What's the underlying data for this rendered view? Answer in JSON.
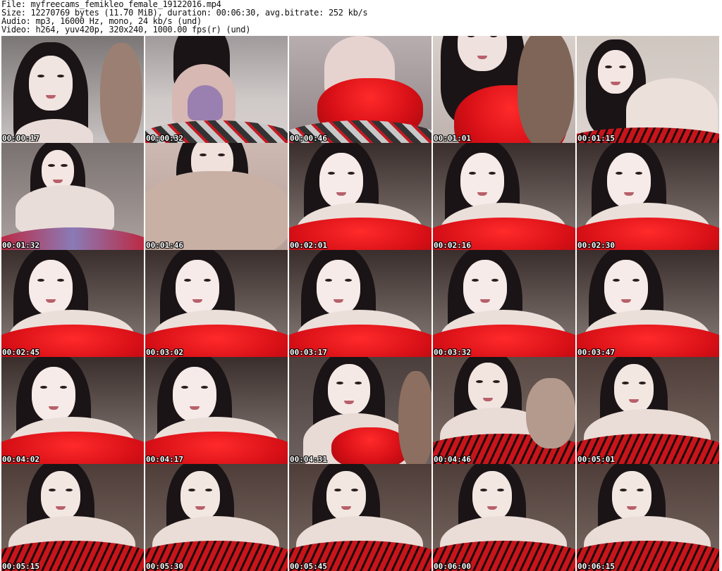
{
  "header": {
    "file_line": "File: myfreecams_femikleo_female_19122016.mp4",
    "size_line": "Size: 12270769 bytes (11.70 MiB), duration: 00:06:30, avg.bitrate: 252 kb/s",
    "audio_line": "Audio: mp3, 16000 Hz, mono, 24 kb/s (und)",
    "video_line": "Video: h264, yuv420p, 320x240, 1000.00 fps(r) (und)"
  },
  "colors": {
    "background": "#ffffff",
    "text": "#111111",
    "timestamp": "#ffffff",
    "blanket_red": "#e0141c",
    "skin": "#f4e6e2",
    "hair": "#1a1416"
  },
  "thumbnails": [
    {
      "time": "00:00:17",
      "scene": "closeup-left-hand"
    },
    {
      "time": "00:00:32",
      "scene": "sitting-bed"
    },
    {
      "time": "00:00:46",
      "scene": "red-blanket-move"
    },
    {
      "time": "00:01:01",
      "scene": "blur-red"
    },
    {
      "time": "00:01:15",
      "scene": "lying-bed"
    },
    {
      "time": "00:01:32",
      "scene": "lying-purple"
    },
    {
      "time": "00:01:46",
      "scene": "hand-closeup"
    },
    {
      "time": "00:02:01",
      "scene": "face-red-pillow"
    },
    {
      "time": "00:02:16",
      "scene": "face-red-pillow"
    },
    {
      "time": "00:02:30",
      "scene": "face-red-pillow"
    },
    {
      "time": "00:02:45",
      "scene": "face-red-pillow"
    },
    {
      "time": "00:03:02",
      "scene": "face-red-pillow"
    },
    {
      "time": "00:03:17",
      "scene": "face-red-pillow"
    },
    {
      "time": "00:03:32",
      "scene": "face-red-pillow"
    },
    {
      "time": "00:03:47",
      "scene": "face-red-pillow"
    },
    {
      "time": "00:04:02",
      "scene": "face-red-pillow"
    },
    {
      "time": "00:04:17",
      "scene": "face-red-pillow"
    },
    {
      "time": "00:04:31",
      "scene": "tilted-hand"
    },
    {
      "time": "00:04:46",
      "scene": "tiger-blanket-hand"
    },
    {
      "time": "00:05:01",
      "scene": "tiger-blanket"
    },
    {
      "time": "00:05:15",
      "scene": "tiger-blanket"
    },
    {
      "time": "00:05:30",
      "scene": "tiger-blanket"
    },
    {
      "time": "00:05:45",
      "scene": "tiger-blanket"
    },
    {
      "time": "00:06:00",
      "scene": "tiger-blanket"
    },
    {
      "time": "00:06:15",
      "scene": "tiger-blanket"
    }
  ]
}
